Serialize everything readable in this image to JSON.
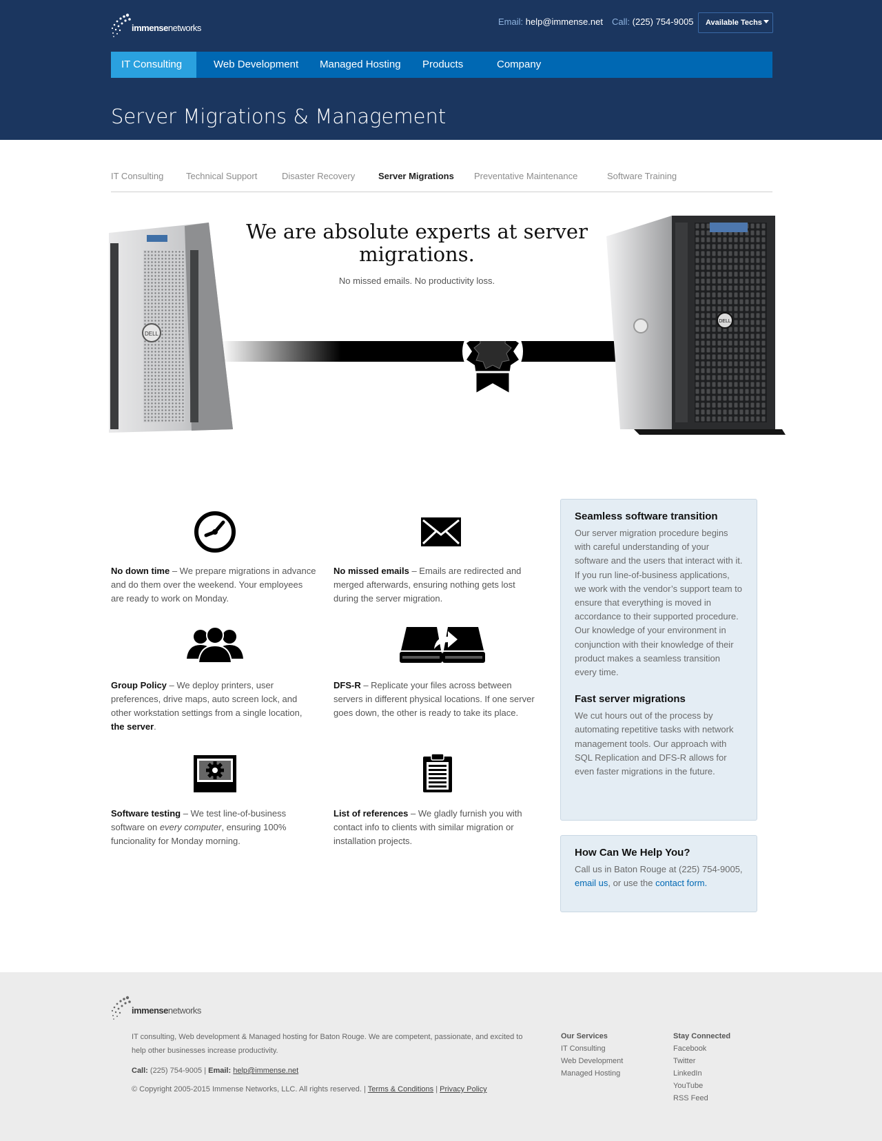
{
  "header": {
    "logo_text_bold": "immense",
    "logo_text_light": "networks",
    "email_label": "Email:",
    "email_value": "help@immense.net",
    "call_label": "Call:",
    "call_value": "(225) 754-9005",
    "techs_label": "Available Techs"
  },
  "main_nav": [
    "IT Consulting",
    "Web Development",
    "Managed Hosting",
    "Products",
    "Company"
  ],
  "page_title": "Server Migrations & Management",
  "sub_nav": [
    "IT Consulting",
    "Technical Support",
    "Disaster Recovery",
    "Server Migrations",
    "Preventative Maintenance",
    "Software Training"
  ],
  "hero": {
    "title": "We are absolute experts at server migrations.",
    "subtitle": "No missed emails. No productivity loss."
  },
  "features": [
    {
      "title": "No down time",
      "text": " – We prepare migrations in advance and do them over the weekend. Your employees are ready to work on Monday.",
      "icon": "clock-icon"
    },
    {
      "title": "No missed emails",
      "text": " – Emails are redirected and merged afterwards, ensuring nothing gets lost during the server migration.",
      "icon": "envelope-icon"
    },
    {
      "title": "Group Policy",
      "text": " – We deploy printers, user preferences, drive maps, auto screen lock, and other workstation settings from a single location, ",
      "strong_tail": "the server",
      "tail": ".",
      "icon": "users-icon"
    },
    {
      "title": "DFS-R",
      "text": " – Replicate your files across between servers in different physical locations. If one server goes down, the other is ready to take its place.",
      "icon": "replicate-drives-icon"
    },
    {
      "title": "Software testing",
      "text_a": " – We test line-of-business software on ",
      "em": "every computer",
      "text_b": ", ensuring 100% funcionality for Monday morning.",
      "icon": "monitor-gear-icon"
    },
    {
      "title": "List of references",
      "text": " – We gladly furnish you with contact info to clients with similar migration or installation projects.",
      "icon": "clipboard-icon"
    }
  ],
  "sidebar": {
    "box1_h1": "Seamless software transition",
    "box1_p1": "Our server migration procedure begins with careful understanding of your software and the users that interact with it. If you run line-of-business applications, we work with the vendor’s support team to ensure that everything is moved in accordance to their supported procedure. Our knowledge of your environment in conjunction with their knowledge of their product makes a seamless transition every time.",
    "box1_h2": "Fast server migrations",
    "box1_p2": "We cut hours out of the process by automating repetitive tasks with network management tools. Our approach with SQL Replication and DFS-R allows for even faster migrations in the future.",
    "box2_h": "How Can We Help You?",
    "box2_text_a": "Call us in Baton Rouge at (225) 754-9005, ",
    "box2_link1": "email us",
    "box2_text_b": ", or use the ",
    "box2_link2": "contact form",
    "box2_text_c": "."
  },
  "footer": {
    "logo_text_bold": "immense",
    "logo_text_light": "networks",
    "about": "IT consulting, Web development & Managed hosting for Baton Rouge. We are competent, passionate, and excited to help other businesses increase productivity.",
    "call_label": "Call:",
    "call_value": "(225) 754-9005",
    "sep": "|",
    "email_label": "Email:",
    "email_value": "help@immense.net",
    "copyright": "© Copyright 2005-2015 Immense Networks, LLC. All rights reserved.",
    "terms": "Terms & Conditions",
    "privacy": "Privacy Policy",
    "services_heading": "Our Services",
    "services": [
      "IT Consulting",
      "Web Development",
      "Managed Hosting"
    ],
    "connected_heading": "Stay Connected",
    "connected": [
      "Facebook",
      "Twitter",
      "LinkedIn",
      "YouTube",
      "RSS Feed"
    ]
  },
  "colors": {
    "header_bg": "#1b365f",
    "nav_bg": "#0068b3",
    "nav_active": "#2aa1df",
    "sidebar_bg": "#e4edf4",
    "link": "#0068b3",
    "footer_bg": "#ececec"
  }
}
